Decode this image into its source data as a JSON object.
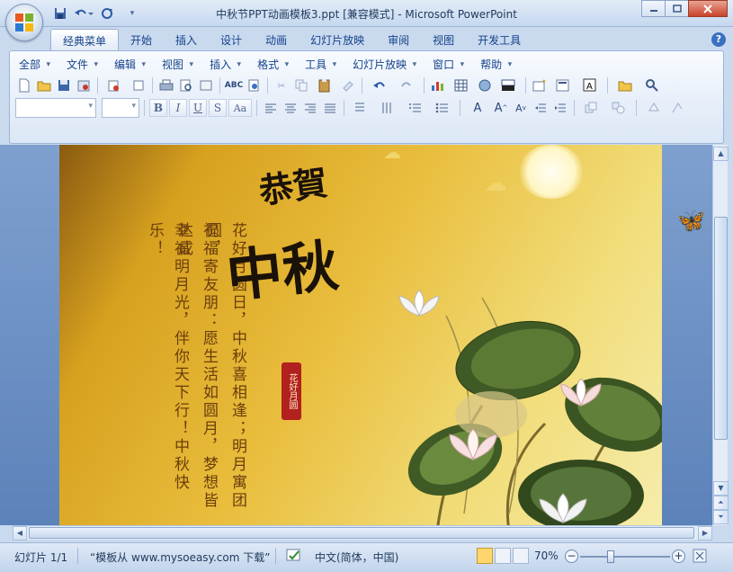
{
  "window": {
    "title": "中秋节PPT动画模板3.ppt [兼容模式] - Microsoft PowerPoint"
  },
  "qat": {
    "icons": [
      "save-icon",
      "undo-icon",
      "redo-icon",
      "customize-qat-icon"
    ]
  },
  "tabs": [
    {
      "label": "经典菜单",
      "active": true
    },
    {
      "label": "开始"
    },
    {
      "label": "插入"
    },
    {
      "label": "设计"
    },
    {
      "label": "动画"
    },
    {
      "label": "幻灯片放映"
    },
    {
      "label": "审阅"
    },
    {
      "label": "视图"
    },
    {
      "label": "开发工具"
    }
  ],
  "menubar": [
    "全部",
    "文件",
    "编辑",
    "视图",
    "插入",
    "格式",
    "工具",
    "幻灯片放映",
    "窗口",
    "帮助"
  ],
  "format_buttons": [
    "B",
    "I",
    "U",
    "S",
    "Aa"
  ],
  "slide": {
    "vertical_text_1": "花好月圆日，中秋喜相逢；明月寓团圆，",
    "vertical_text_2": "祝福寄友朋：愿生活如圆月，梦想皆达成",
    "vertical_text_3": "幸福明月光，伴你天下行！中秋快乐！",
    "calligraphy_top": "恭賀",
    "calligraphy_main": "中秋",
    "seal_text": "花好月圆"
  },
  "status": {
    "slide_info": "幻灯片 1/1",
    "theme": "“模板从 www.mysoeasy.com 下载”",
    "language": "中文(简体，中国)",
    "zoom": "70%"
  },
  "colors": {
    "ribbon_text": "#15428b",
    "slide_gold": "#e9bd3c",
    "seal_red": "#b1211e"
  }
}
